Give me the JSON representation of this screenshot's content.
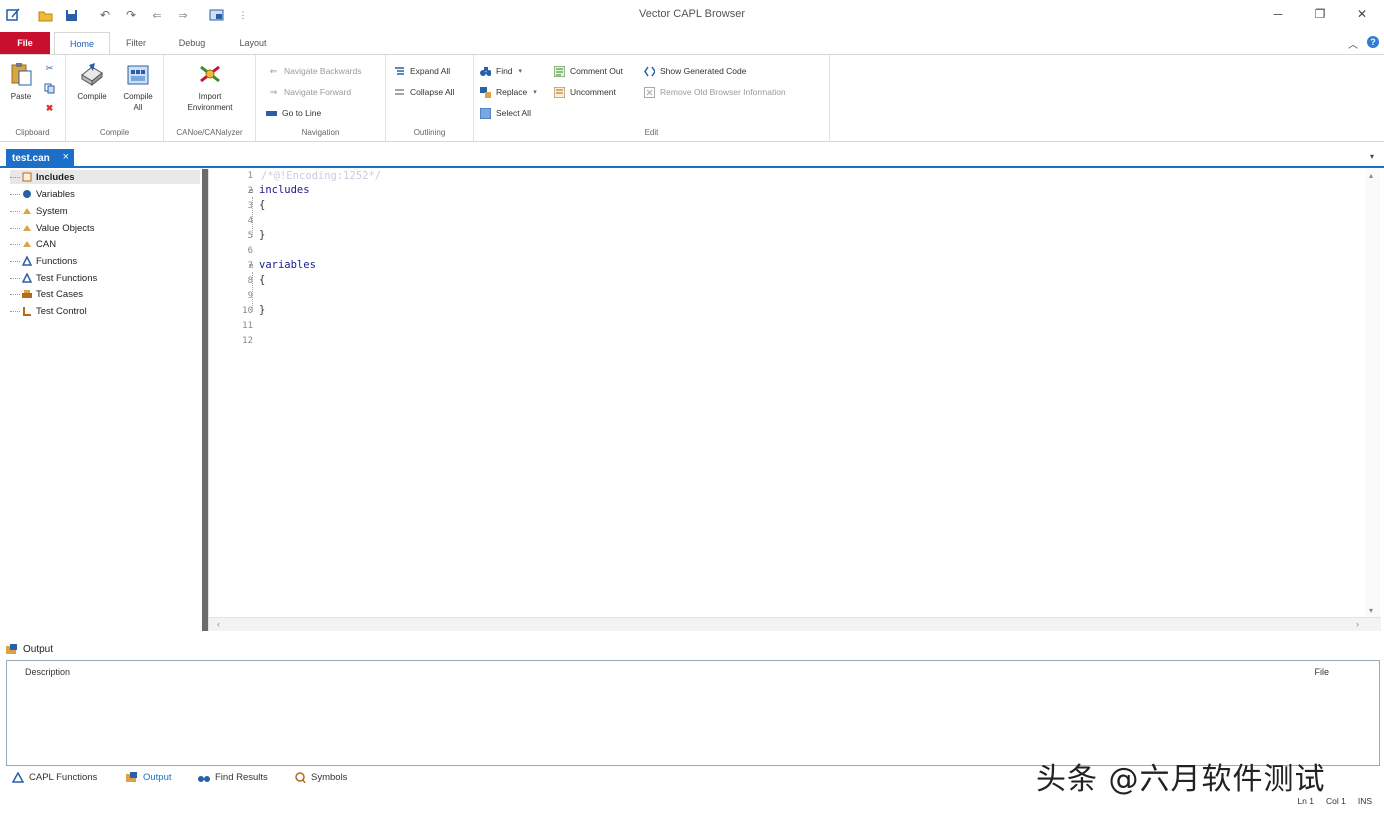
{
  "window": {
    "title": "Vector CAPL Browser"
  },
  "ribbon": {
    "tabs": [
      "File",
      "Home",
      "Filter",
      "Debug",
      "Layout"
    ],
    "groups": {
      "clipboard": {
        "label": "Clipboard",
        "paste": "Paste"
      },
      "compile": {
        "label": "Compile",
        "compile": "Compile",
        "compile_all": "Compile All"
      },
      "import": {
        "label": "CANoe/CANalyzer",
        "import_environment": "Import Environment"
      },
      "navigation": {
        "label": "Navigation",
        "back": "Navigate Backwards",
        "forward": "Navigate Forward",
        "goto_line": "Go to Line"
      },
      "outlining": {
        "label": "Outlining",
        "expand_all": "Expand All",
        "collapse_all": "Collapse All"
      },
      "edit": {
        "label": "Edit",
        "find": "Find",
        "replace": "Replace",
        "select_all": "Select All",
        "comment_out": "Comment Out",
        "uncomment": "Uncomment",
        "show_generated_code": "Show Generated Code",
        "remove_old_info": "Remove Old Browser Information"
      }
    }
  },
  "document": {
    "tab": "test.can"
  },
  "tree": {
    "items": [
      "Includes",
      "Variables",
      "System",
      "Value Objects",
      "CAN",
      "Functions",
      "Test Functions",
      "Test Cases",
      "Test Control"
    ]
  },
  "editor": {
    "line_numbers": [
      "1",
      "2",
      "3",
      "4",
      "5",
      "6",
      "7",
      "8",
      "9",
      "10",
      "11",
      "12"
    ],
    "header_comment": "/*@!Encoding:1252*/",
    "includes_kw": "includes",
    "variables_kw": "variables",
    "open_brace": "{",
    "close_brace": "}"
  },
  "output": {
    "title": "Output",
    "col_description": "Description",
    "col_file": "File"
  },
  "bottom_tabs": [
    "CAPL Functions",
    "Output",
    "Find Results",
    "Symbols"
  ],
  "status": {
    "line": "Ln 1",
    "col": "Col 1",
    "mode": "INS"
  },
  "watermark": "头条 @六月软件测试"
}
